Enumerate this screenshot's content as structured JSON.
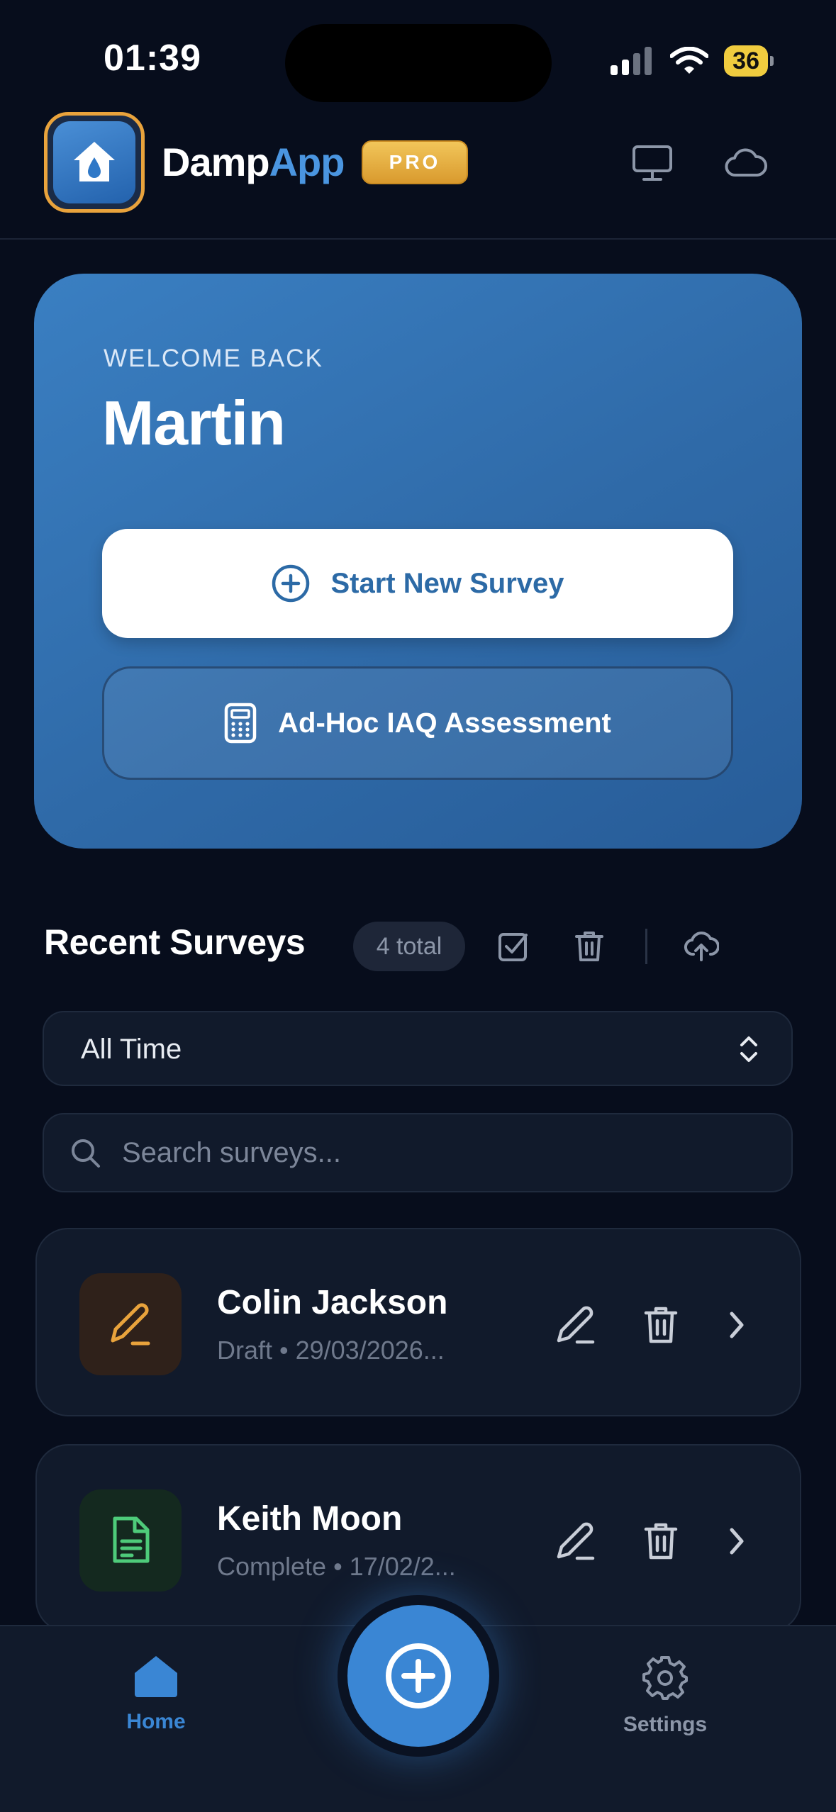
{
  "status_bar": {
    "time": "01:39",
    "battery": "36"
  },
  "header": {
    "brand_part1": "Damp",
    "brand_part2": "App",
    "badge": "PRO"
  },
  "welcome": {
    "label": "WELCOME BACK",
    "name": "Martin",
    "primary_button": "Start New Survey",
    "secondary_button": "Ad-Hoc IAQ Assessment"
  },
  "recent": {
    "title": "Recent Surveys",
    "total": "4 total",
    "filter": {
      "selected": "All Time"
    },
    "search": {
      "placeholder": "Search surveys..."
    },
    "items": [
      {
        "name": "Colin Jackson",
        "meta": "Draft • 29/03/2026...",
        "status": "draft"
      },
      {
        "name": "Keith Moon",
        "meta": "Complete • 17/02/2...",
        "status": "complete"
      }
    ]
  },
  "nav": {
    "home": "Home",
    "settings": "Settings"
  },
  "colors": {
    "background": "#070d1c",
    "card": "#111a2b",
    "accent": "#3a86d4",
    "pro_gold": "#e9a33c",
    "draft": "#e9a33c",
    "complete": "#4ecb7a"
  },
  "icons": [
    "signal-icon",
    "wifi-icon",
    "battery-icon",
    "house-drop-icon",
    "monitor-icon",
    "cloud-icon",
    "plus-circle-icon",
    "calculator-icon",
    "checkbox-icon",
    "trash-icon",
    "cloud-upload-icon",
    "chevron-updown-icon",
    "search-icon",
    "pencil-icon",
    "document-icon",
    "chevron-right-icon",
    "home-icon",
    "gear-icon"
  ]
}
